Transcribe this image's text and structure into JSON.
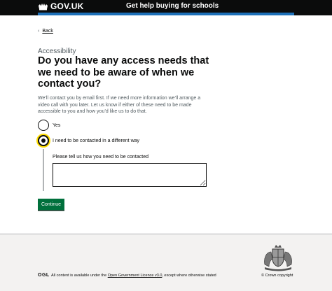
{
  "header": {
    "logo_text": "GOV.UK",
    "service_name": "Get help buying for schools"
  },
  "back_link": "Back",
  "caption": "Accessibility",
  "heading": "Do you have any access needs that we need to be aware of when we contact you?",
  "hint": "We’ll contact you by email first. If we need more information we’ll arrange a video call with you later. Let us know if either of these need to be made accessible to you and how you’d like us to do that.",
  "options": [
    {
      "label": "Yes",
      "selected": false
    },
    {
      "label": "I need to be contacted in a different way",
      "selected": true
    }
  ],
  "conditional": {
    "label": "Please tell us how you need to be contacted",
    "value": ""
  },
  "continue_button": "Continue",
  "footer": {
    "ogl": "OGL",
    "licence_prefix": "All content is available under the ",
    "licence_link": "Open Government Licence v3.0",
    "licence_suffix": ", except where otherwise stated",
    "copyright": "© Crown copyright"
  },
  "colors": {
    "header_bg": "#0b0c0c",
    "brand_blue": "#1d70b8",
    "focus_yellow": "#ffdd00",
    "button_green": "#00703c",
    "footer_bg": "#f3f2f1"
  }
}
